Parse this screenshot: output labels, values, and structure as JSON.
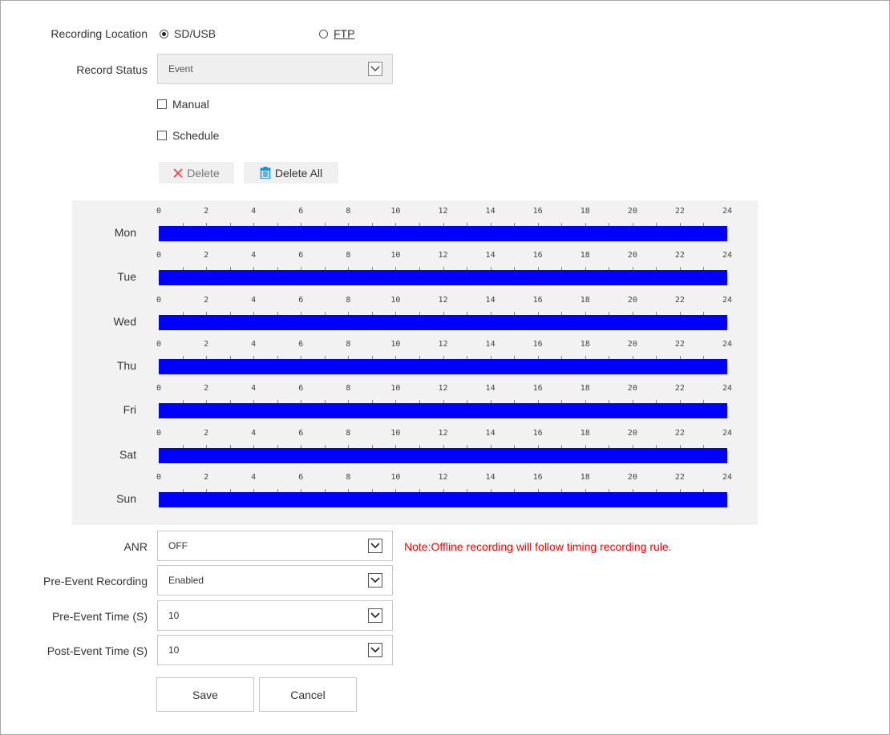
{
  "recording_location": {
    "label": "Recording Location",
    "options": [
      {
        "label": "SD/USB",
        "selected": true
      },
      {
        "label": "FTP",
        "selected": false
      }
    ]
  },
  "record_status": {
    "label": "Record Status",
    "value": "Event",
    "disabled": true
  },
  "modes": {
    "manual": {
      "label": "Manual",
      "checked": false
    },
    "schedule": {
      "label": "Schedule",
      "checked": false
    }
  },
  "toolbar": {
    "delete_label": "Delete",
    "delete_all_label": "Delete All",
    "delete_icon_color": "#ff3b3b",
    "delete_all_icon_color": "#1a8fd8"
  },
  "schedule": {
    "hour_ticks": [
      "0",
      "2",
      "4",
      "6",
      "8",
      "10",
      "12",
      "14",
      "16",
      "18",
      "20",
      "22",
      "24"
    ],
    "bar_color": "#0000ff",
    "days": [
      {
        "label": "Mon",
        "segments": [
          [
            0,
            24
          ]
        ]
      },
      {
        "label": "Tue",
        "segments": [
          [
            0,
            24
          ]
        ]
      },
      {
        "label": "Wed",
        "segments": [
          [
            0,
            24
          ]
        ]
      },
      {
        "label": "Thu",
        "segments": [
          [
            0,
            24
          ]
        ]
      },
      {
        "label": "Fri",
        "segments": [
          [
            0,
            24
          ]
        ]
      },
      {
        "label": "Sat",
        "segments": [
          [
            0,
            24
          ]
        ]
      },
      {
        "label": "Sun",
        "segments": [
          [
            0,
            24
          ]
        ]
      }
    ]
  },
  "anr": {
    "label": "ANR",
    "value": "OFF",
    "note": "Note:Offline recording will follow timing recording rule."
  },
  "pre_event_recording": {
    "label": "Pre-Event Recording",
    "value": "Enabled"
  },
  "pre_event_time": {
    "label": "Pre-Event Time (S)",
    "value": "10"
  },
  "post_event_time": {
    "label": "Post-Event Time (S)",
    "value": "10"
  },
  "buttons": {
    "save": "Save",
    "cancel": "Cancel"
  }
}
